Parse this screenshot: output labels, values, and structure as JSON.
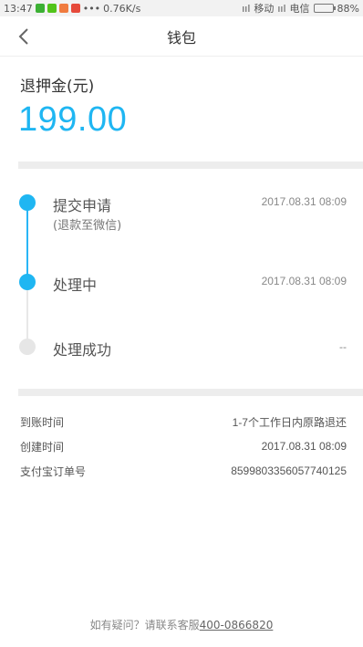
{
  "status_bar": {
    "time": "13:47",
    "speed": "0.76K/s",
    "carrier_1": "移动",
    "carrier_2": "电信",
    "battery": "88%",
    "battery_level": 0.88
  },
  "nav": {
    "title": "钱包"
  },
  "deposit": {
    "label": "退押金(元)",
    "amount": "199.00"
  },
  "timeline": [
    {
      "title": "提交申请",
      "subtitle": "(退款至微信)",
      "time": "2017.08.31 08:09",
      "done": true
    },
    {
      "title": "处理中",
      "subtitle": "",
      "time": "2017.08.31 08:09",
      "done": true
    },
    {
      "title": "处理成功",
      "subtitle": "",
      "time": "--",
      "done": false
    }
  ],
  "info": {
    "arrival_label": "到账时间",
    "arrival_value": "1-7个工作日内原路退还",
    "created_label": "创建时间",
    "created_value": "2017.08.31 08:09",
    "order_label": "支付宝订单号",
    "order_value": "8599803356057740125"
  },
  "footer": {
    "prefix": "如有疑问？请联系客服",
    "phone": "400-0866820"
  },
  "colors": {
    "accent": "#1fb6f2",
    "inactive": "#e6e6e6"
  }
}
